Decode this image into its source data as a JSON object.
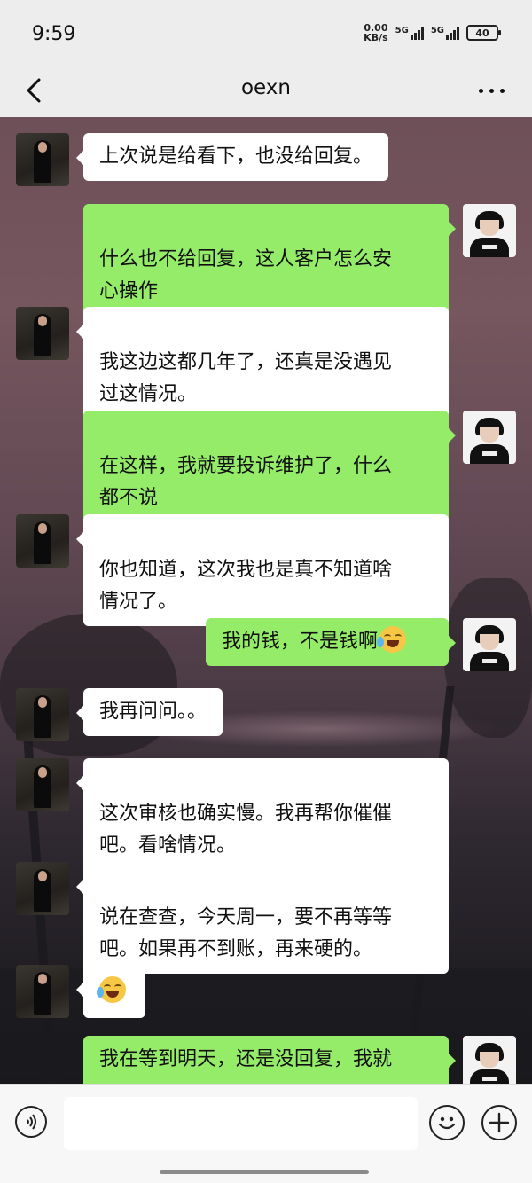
{
  "status_bar": {
    "time": "9:59",
    "net_speed_value": "0.00",
    "net_speed_unit": "KB/s",
    "signal1_label": "5G",
    "signal2_label": "5G",
    "battery": "40"
  },
  "header": {
    "title": "oexn",
    "back_icon": "chevron-left-icon",
    "more_icon": "more-dots-icon"
  },
  "messages": [
    {
      "side": "left",
      "text": "上次说是给看下，也没给回复。"
    },
    {
      "side": "right",
      "text": "什么也不给回复，这人客户怎么安\n心操作"
    },
    {
      "side": "left",
      "text": "我这边这都几年了，还真是没遇见\n过这情况。"
    },
    {
      "side": "right",
      "text": "在这样，我就要投诉维护了，什么\n都不说"
    },
    {
      "side": "left",
      "text": "你也知道，这次我也是真不知道啥\n情况了。"
    },
    {
      "side": "right",
      "text": "我的钱，不是钱啊",
      "emoji": "loudly-crying-face"
    },
    {
      "side": "left",
      "text": "我再问问。。"
    },
    {
      "side": "left",
      "text": "这次审核也确实慢。我再帮你催催\n吧。看啥情况。"
    },
    {
      "side": "left",
      "text": "说在查查，今天周一，要不再等等\n吧。如果再不到账，再来硬的。"
    },
    {
      "side": "left",
      "text": "",
      "emoji": "loudly-crying-face"
    },
    {
      "side": "right",
      "text": "我在等到明天，还是没回复，我就"
    }
  ],
  "input_bar": {
    "voice_icon": "voice-icon",
    "input_value": "",
    "emoji_icon": "emoji-smile-icon",
    "plus_icon": "plus-icon"
  },
  "colors": {
    "bubble_right": "#95ec69",
    "bubble_left": "#ffffff",
    "bar_background": "#ededed"
  }
}
